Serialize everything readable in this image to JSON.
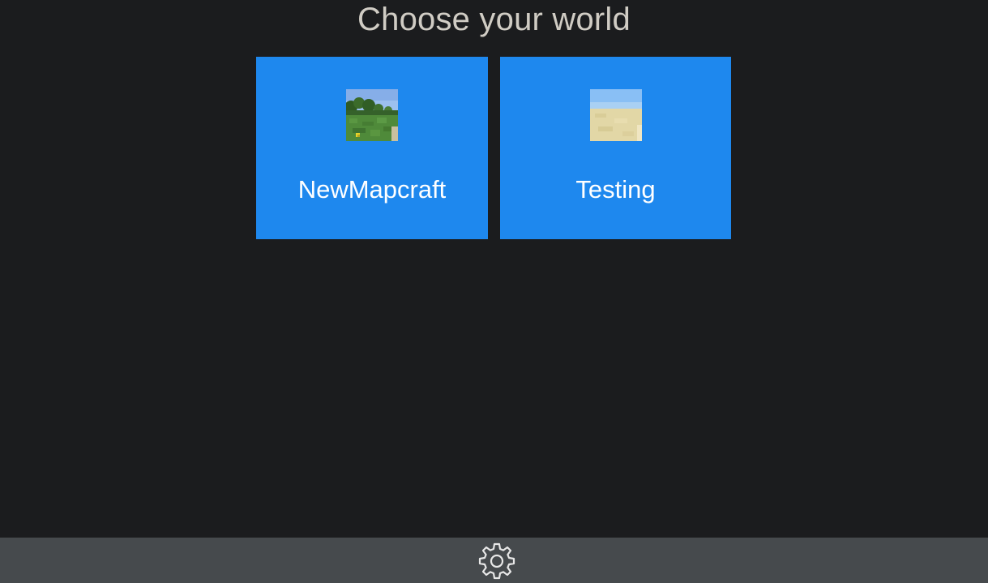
{
  "header": {
    "title": "Choose your world"
  },
  "worlds": [
    {
      "name": "NewMapcraft",
      "thumbnail_icon": "grass-landscape-thumbnail-icon"
    },
    {
      "name": "Testing",
      "thumbnail_icon": "sand-landscape-thumbnail-icon"
    }
  ],
  "footer": {
    "settings_icon": "gear-icon"
  },
  "colors": {
    "background": "#1b1c1e",
    "tile": "#1e88ee",
    "footer": "#464a4d",
    "title_text": "#d0ccc4"
  }
}
